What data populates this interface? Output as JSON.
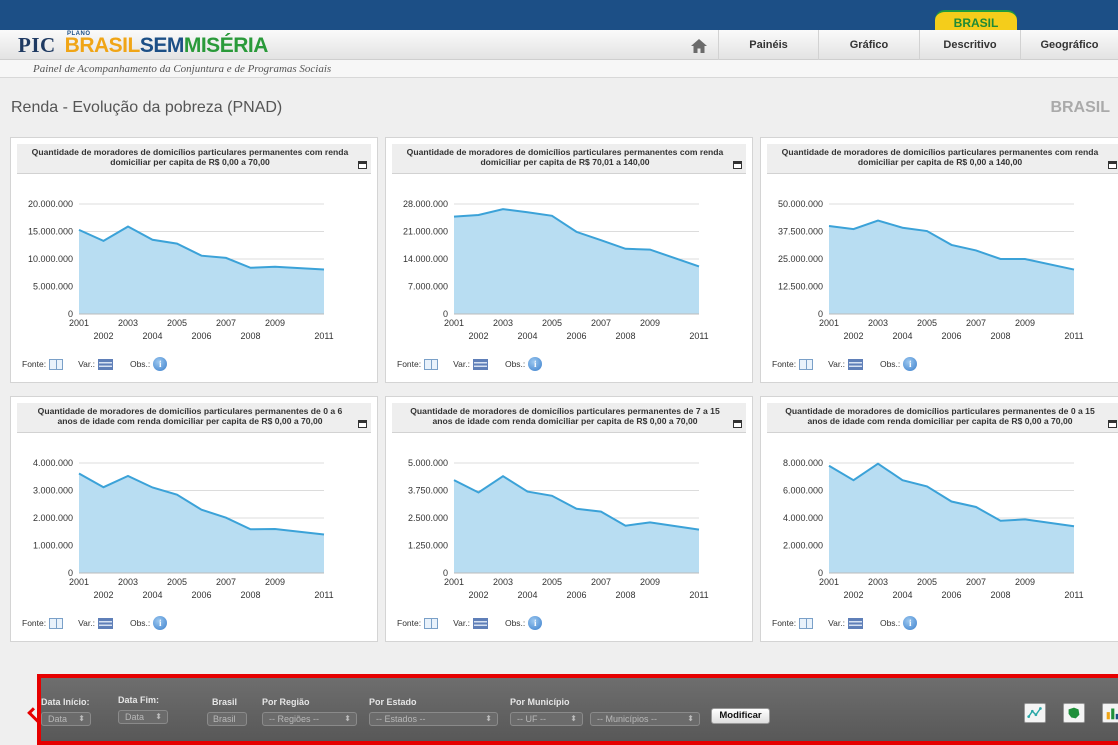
{
  "header": {
    "logo": {
      "pic": "PIC",
      "plano": "PLANO",
      "brasil": "BRASIL",
      "sem": "SEM",
      "miseria": "MISÉRIA"
    },
    "brasil_tab": "BRASIL",
    "nav": [
      {
        "label": "Painéis"
      },
      {
        "label": "Gráfico"
      },
      {
        "label": "Descritivo"
      },
      {
        "label": "Geográfico"
      }
    ],
    "subtitle": "Painel de Acompanhamento da Conjuntura e de Programas Sociais"
  },
  "page": {
    "title": "Renda - Evolução da pobreza (PNAD)",
    "region": "BRASIL"
  },
  "footer_labels": {
    "fonte": "Fonte:",
    "var": "Var.:",
    "obs": "Obs.:",
    "info_glyph": "i"
  },
  "chart_data": [
    {
      "type": "area",
      "title": "Quantidade de moradores de domicílios particulares permanentes com renda domiciliar per capita de R$ 0,00 a 70,00",
      "x": [
        2001,
        2002,
        2003,
        2004,
        2005,
        2006,
        2007,
        2008,
        2009,
        2011
      ],
      "x_labels": [
        "2001",
        "2002",
        "2003",
        "2004",
        "2005",
        "2006",
        "2007",
        "2008",
        "2009",
        "2011"
      ],
      "values": [
        15300000,
        13300000,
        15900000,
        13500000,
        12800000,
        10600000,
        10200000,
        8400000,
        8600000,
        8100000
      ],
      "ylim": [
        0,
        20000000
      ],
      "y_ticks": [
        "0",
        "5.000.000",
        "10.000.000",
        "15.000.000",
        "20.000.000"
      ],
      "color": "#3ba2d8"
    },
    {
      "type": "area",
      "title": "Quantidade de moradores de domicílios particulares permanentes com renda domiciliar per capita de R$ 70,01 a 140,00",
      "x": [
        2001,
        2002,
        2003,
        2004,
        2005,
        2006,
        2007,
        2008,
        2009,
        2011
      ],
      "x_labels": [
        "2001",
        "2002",
        "2003",
        "2004",
        "2005",
        "2006",
        "2007",
        "2008",
        "2009",
        "2011"
      ],
      "values": [
        24800000,
        25200000,
        26700000,
        25900000,
        25000000,
        20900000,
        18800000,
        16600000,
        16400000,
        12100000
      ],
      "ylim": [
        0,
        28000000
      ],
      "y_ticks": [
        "0",
        "7.000.000",
        "14.000.000",
        "21.000.000",
        "28.000.000"
      ],
      "color": "#3ba2d8"
    },
    {
      "type": "area",
      "title": "Quantidade de moradores de domicílios particulares permanentes com renda domiciliar per capita de R$ 0,00 a 140,00",
      "x": [
        2001,
        2002,
        2003,
        2004,
        2005,
        2006,
        2007,
        2008,
        2009,
        2011
      ],
      "x_labels": [
        "2001",
        "2002",
        "2003",
        "2004",
        "2005",
        "2006",
        "2007",
        "2008",
        "2009",
        "2011"
      ],
      "values": [
        40000000,
        38600000,
        42500000,
        39200000,
        37700000,
        31400000,
        28900000,
        25000000,
        25000000,
        20200000
      ],
      "ylim": [
        0,
        50000000
      ],
      "y_ticks": [
        "0",
        "12.500.000",
        "25.000.000",
        "37.500.000",
        "50.000.000"
      ],
      "color": "#3ba2d8"
    },
    {
      "type": "area",
      "title": "Quantidade de moradores de domicílios particulares permanentes de 0 a 6 anos de idade com renda domiciliar per capita de R$ 0,00 a 70,00",
      "x": [
        2001,
        2002,
        2003,
        2004,
        2005,
        2006,
        2007,
        2008,
        2009,
        2011
      ],
      "x_labels": [
        "2001",
        "2002",
        "2003",
        "2004",
        "2005",
        "2006",
        "2007",
        "2008",
        "2009",
        "2011"
      ],
      "values": [
        3620000,
        3120000,
        3530000,
        3110000,
        2850000,
        2300000,
        2010000,
        1590000,
        1600000,
        1400000
      ],
      "ylim": [
        0,
        4000000
      ],
      "y_ticks": [
        "0",
        "1.000.000",
        "2.000.000",
        "3.000.000",
        "4.000.000"
      ],
      "color": "#3ba2d8"
    },
    {
      "type": "area",
      "title": "Quantidade de moradores de domicílios particulares permanentes de 7 a 15 anos de idade com renda domiciliar per capita de R$ 0,00 a 70,00",
      "x": [
        2001,
        2002,
        2003,
        2004,
        2005,
        2006,
        2007,
        2008,
        2009,
        2011
      ],
      "x_labels": [
        "2001",
        "2002",
        "2003",
        "2004",
        "2005",
        "2006",
        "2007",
        "2008",
        "2009",
        "2011"
      ],
      "values": [
        4220000,
        3660000,
        4400000,
        3700000,
        3510000,
        2920000,
        2790000,
        2150000,
        2300000,
        1970000
      ],
      "ylim": [
        0,
        5000000
      ],
      "y_ticks": [
        "0",
        "1.250.000",
        "2.500.000",
        "3.750.000",
        "5.000.000"
      ],
      "color": "#3ba2d8"
    },
    {
      "type": "area",
      "title": "Quantidade de moradores de domicílios particulares permanentes de 0 a 15 anos de idade com renda domiciliar per capita de R$ 0,00 a 70,00",
      "x": [
        2001,
        2002,
        2003,
        2004,
        2005,
        2006,
        2007,
        2008,
        2009,
        2011
      ],
      "x_labels": [
        "2001",
        "2002",
        "2003",
        "2004",
        "2005",
        "2006",
        "2007",
        "2008",
        "2009",
        "2011"
      ],
      "values": [
        7800000,
        6750000,
        7950000,
        6750000,
        6300000,
        5200000,
        4800000,
        3800000,
        3900000,
        3400000
      ],
      "ylim": [
        0,
        8000000
      ],
      "y_ticks": [
        "0",
        "2.000.000",
        "4.000.000",
        "6.000.000",
        "8.000.000"
      ],
      "color": "#3ba2d8"
    }
  ],
  "filters": {
    "data_inicio_label": "Data Início:",
    "data_inicio_value": "Data",
    "data_fim_label": "Data Fim:",
    "data_fim_value": "Data",
    "brasil_label": "Brasil",
    "brasil_button": "Brasil",
    "regiao_label": "Por Região",
    "regiao_value": "-- Regiões --",
    "estado_label": "Por Estado",
    "estado_value": "-- Estados --",
    "municipio_label": "Por Município",
    "uf_value": "-- UF --",
    "municipios_value": "-- Municípios --",
    "caret": "⬍",
    "modify_button": "Modificar"
  }
}
